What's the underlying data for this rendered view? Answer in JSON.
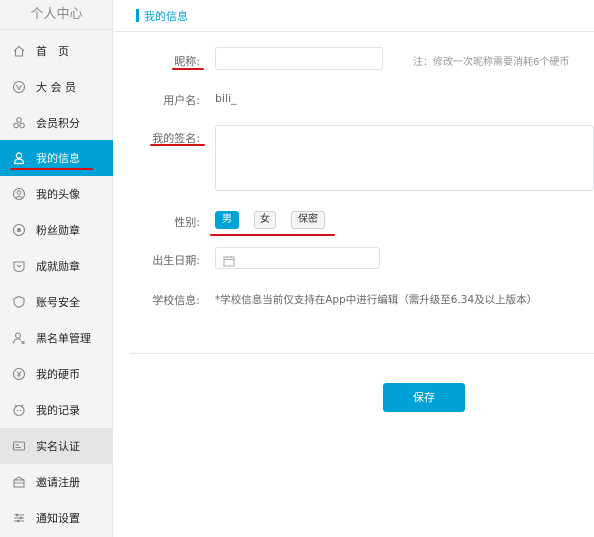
{
  "sidebar": {
    "title": "个人中心",
    "items": [
      {
        "label": "首　页",
        "icon": "home-icon"
      },
      {
        "label": "大 会 员",
        "icon": "vip-icon"
      },
      {
        "label": "会员积分",
        "icon": "points-icon"
      },
      {
        "label": "我的信息",
        "icon": "user-icon"
      },
      {
        "label": "我的头像",
        "icon": "avatar-icon"
      },
      {
        "label": "粉丝勋章",
        "icon": "medal-icon"
      },
      {
        "label": "成就勋章",
        "icon": "achievement-icon"
      },
      {
        "label": "账号安全",
        "icon": "shield-icon"
      },
      {
        "label": "黑名单管理",
        "icon": "blacklist-icon"
      },
      {
        "label": "我的硬币",
        "icon": "coin-icon"
      },
      {
        "label": "我的记录",
        "icon": "record-icon"
      },
      {
        "label": "实名认证",
        "icon": "id-card-icon"
      },
      {
        "label": "邀请注册",
        "icon": "invite-icon"
      },
      {
        "label": "通知设置",
        "icon": "settings-icon"
      }
    ]
  },
  "breadcrumb": {
    "title": "我的信息"
  },
  "form": {
    "nickname_label": "昵称:",
    "nickname_value": "",
    "nickname_note": "注：修改一次昵称需要消耗6个硬币",
    "username_label": "用户名:",
    "username_value": "bili_",
    "signature_label": "我的签名:",
    "signature_value": "",
    "gender_label": "性别:",
    "gender_options": [
      "男",
      "女",
      "保密"
    ],
    "gender_selected": "男",
    "birthday_label": "出生日期:",
    "birthday_value": "",
    "school_label": "学校信息:",
    "school_note": "*学校信息当前仅支持在App中进行编辑（需升级至6.34及以上版本）"
  },
  "save_label": "保存",
  "colors": {
    "accent": "#00a1d6",
    "annotation": "#d41414"
  }
}
